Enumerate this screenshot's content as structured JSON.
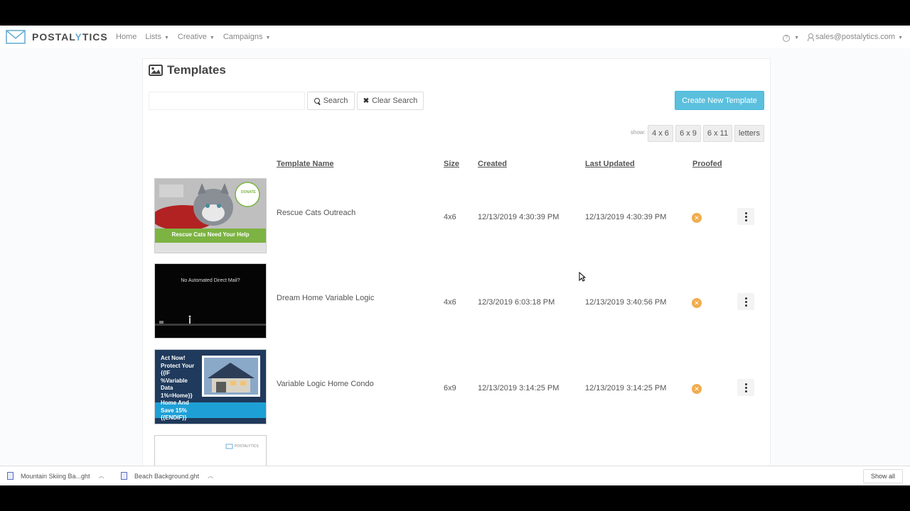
{
  "nav": {
    "brand": "POSTALYTICS",
    "brand_main": "POSTAL",
    "brand_accent": "Y",
    "brand_tail": "TICS",
    "links": [
      "Home",
      "Lists",
      "Creative",
      "Campaigns"
    ],
    "help_symbol": "?",
    "user_email": "sales@postalytics.com"
  },
  "page": {
    "title": "Templates",
    "search_placeholder": "",
    "search_label": "Search",
    "clear_label": "Clear Search",
    "create_label": "Create New Template",
    "show_label": "show:",
    "filters": [
      "4 x 6",
      "6 x 9",
      "6 x 11",
      "letters"
    ]
  },
  "table": {
    "headers": {
      "name": "Template Name",
      "size": "Size",
      "created": "Created",
      "updated": "Last Updated",
      "proofed": "Proofed"
    },
    "rows": [
      {
        "name": "Rescue Cats Outreach",
        "size": "4x6",
        "created": "12/13/2019 4:30:39 PM",
        "updated": "12/13/2019 4:30:39 PM",
        "proofed_icon": "x-circle-icon"
      },
      {
        "name": "Dream Home Variable Logic",
        "size": "4x6",
        "created": "12/3/2019 6:03:18 PM",
        "updated": "12/13/2019 3:40:56 PM",
        "proofed_icon": "x-circle-icon"
      },
      {
        "name": "Variable Logic Home Condo",
        "size": "6x9",
        "created": "12/13/2019 3:14:25 PM",
        "updated": "12/13/2019 3:14:25 PM",
        "proofed_icon": "x-circle-icon"
      }
    ]
  },
  "thumbs": {
    "cats_banner": "Rescue Cats Need Your Help",
    "cats_badge": "DONATE",
    "dream_text": "No Automated Direct Mail?",
    "condo_lines": [
      "Act Now!",
      "Protect Your",
      "{{IF",
      "%Variable",
      "Data",
      "1%=Home}}",
      "Home And",
      "Save 15%",
      "{{ENDIF}}"
    ],
    "logo4": "POSTALYTICS"
  },
  "downloads": {
    "items": [
      "Mountain Skiing Ba...ght",
      "Beach Background.ght"
    ],
    "show_all": "Show all"
  },
  "colors": {
    "accent": "#5bc0de",
    "proofed_no": "#f0ad4e",
    "brand": "#6aaed6"
  }
}
